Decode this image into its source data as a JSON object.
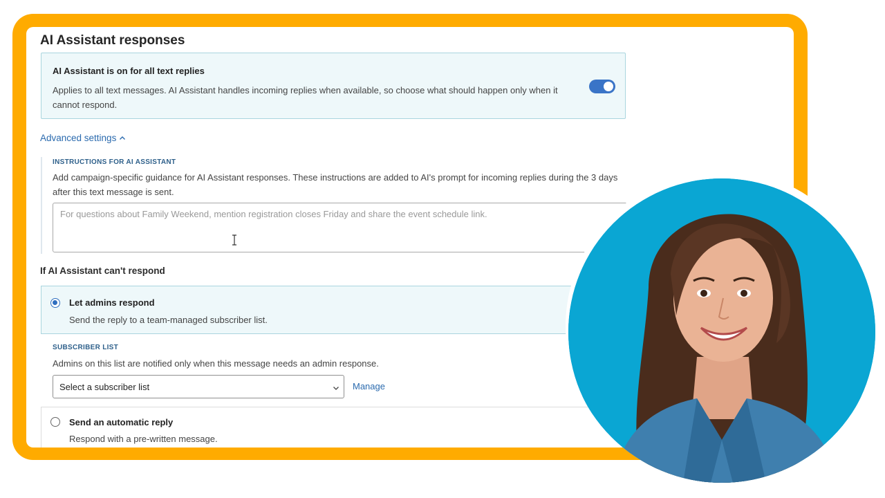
{
  "section": {
    "title": "AI Assistant responses"
  },
  "banner": {
    "title": "AI Assistant is on for all text replies",
    "description": "Applies to all text messages. AI Assistant handles incoming replies when available, so choose what should happen only when it cannot respond.",
    "toggle_on": true
  },
  "advanced": {
    "label": "Advanced settings",
    "icon": "chevron-up-icon"
  },
  "instructions": {
    "label": "INSTRUCTIONS FOR AI ASSISTANT",
    "description": "Add campaign-specific guidance for AI Assistant responses. These instructions are added to AI's prompt for incoming replies during the 3 days after this text message is sent.",
    "placeholder": "For questions about Family Weekend, mention registration closes Friday and share the event schedule link.",
    "value": ""
  },
  "fallback": {
    "title": "If AI Assistant can't respond",
    "options": [
      {
        "title": "Let admins respond",
        "description": "Send the reply to a team-managed subscriber list.",
        "selected": true
      },
      {
        "title": "Send an automatic reply",
        "description": "Respond with a pre-written message.",
        "selected": false
      }
    ]
  },
  "subscriber": {
    "label": "SUBSCRIBER LIST",
    "description": "Admins on this list are notified only when this message needs an admin response.",
    "select_value": "Select a subscriber list",
    "manage_label": "Manage"
  },
  "colors": {
    "frame": "#ffab00",
    "accent": "#3a74c7",
    "link": "#2a6aae",
    "banner_bg": "#eef8fa",
    "portrait_bg": "#0aa6d3"
  }
}
